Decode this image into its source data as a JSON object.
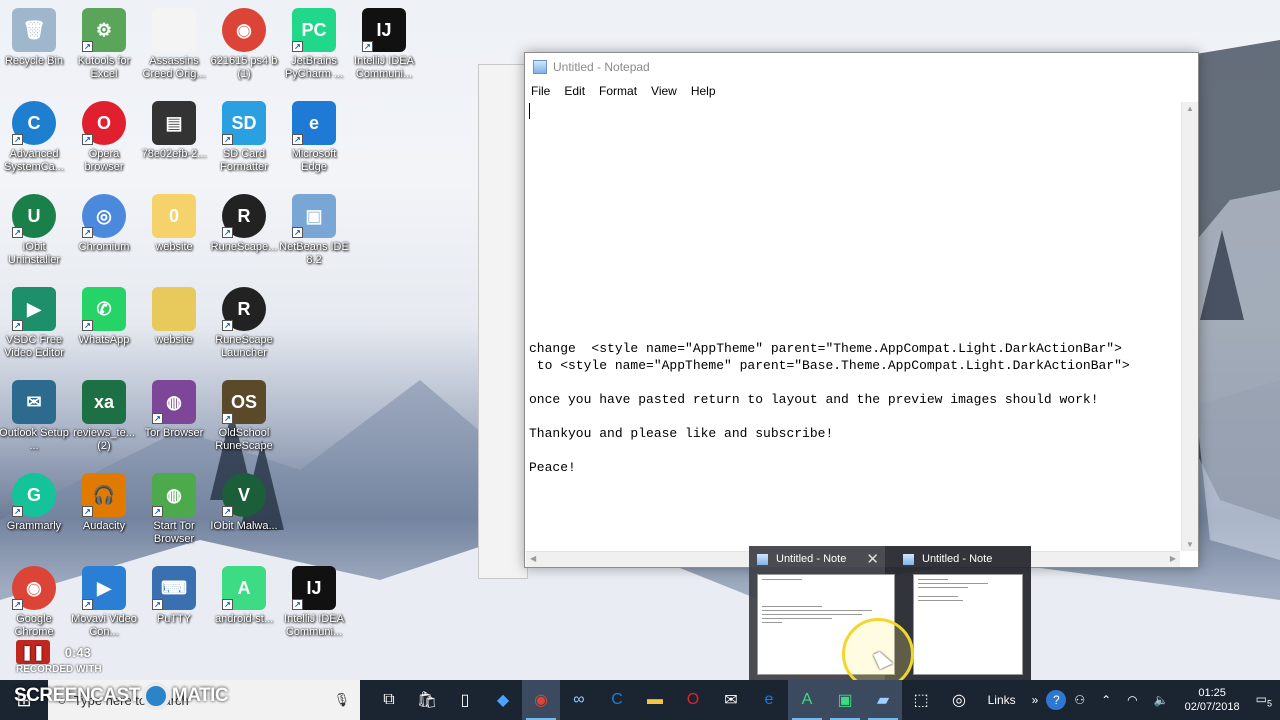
{
  "desktop": {
    "icons": [
      {
        "label": "Recycle Bin",
        "glyph": "🗑",
        "color": "#9fb7cc",
        "shortcut": false
      },
      {
        "label": "Kutools for Excel",
        "glyph": "⚙",
        "color": "#5aa55a",
        "shortcut": true
      },
      {
        "label": "Assassins Creed Orig...",
        "glyph": "",
        "color": "#f4f4f4",
        "shortcut": false
      },
      {
        "label": "621615 ps4 b (1)",
        "glyph": "◉",
        "color": "#db4437",
        "shortcut": false
      },
      {
        "label": "JetBrains PyCharm ...",
        "glyph": "PC",
        "color": "#21d789",
        "shortcut": true
      },
      {
        "label": "IntelliJ IDEA Communi...",
        "glyph": "IJ",
        "color": "#111111",
        "shortcut": true
      },
      {
        "label": "Advanced SystemCa...",
        "glyph": "C",
        "color": "#1e7fd0",
        "shortcut": true
      },
      {
        "label": "Opera browser",
        "glyph": "O",
        "color": "#e0202f",
        "shortcut": true
      },
      {
        "label": "78e02efb-2...",
        "glyph": "▤",
        "color": "#333333",
        "shortcut": false
      },
      {
        "label": "SD Card Formatter",
        "glyph": "SD",
        "color": "#2aa0e0",
        "shortcut": true
      },
      {
        "label": "Microsoft Edge",
        "glyph": "e",
        "color": "#1f7ad6",
        "shortcut": true
      },
      {
        "label": "IObit Uninstaller",
        "glyph": "U",
        "color": "#1b7f4a",
        "shortcut": true
      },
      {
        "label": "Chromium",
        "glyph": "◎",
        "color": "#4a89dc",
        "shortcut": true
      },
      {
        "label": "website",
        "glyph": "0",
        "color": "#f5d36a",
        "shortcut": false
      },
      {
        "label": "RuneScape...",
        "glyph": "R",
        "color": "#222222",
        "shortcut": true
      },
      {
        "label": "NetBeans IDE 8.2",
        "glyph": "▣",
        "color": "#7aa6d6",
        "shortcut": true
      },
      {
        "label": "VSDC Free Video Editor",
        "glyph": "▶",
        "color": "#1d8f6b",
        "shortcut": true
      },
      {
        "label": "WhatsApp",
        "glyph": "✆",
        "color": "#25d366",
        "shortcut": true
      },
      {
        "label": "website",
        "glyph": "",
        "color": "#e8c95c",
        "shortcut": false
      },
      {
        "label": "RuneScape Launcher",
        "glyph": "R",
        "color": "#222222",
        "shortcut": true
      },
      {
        "label": "Outlook Setup ...",
        "glyph": "✉",
        "color": "#2c6a8e",
        "shortcut": false
      },
      {
        "label": "reviews_te... (2)",
        "glyph": "xa",
        "color": "#1d7044",
        "shortcut": false
      },
      {
        "label": "Tor Browser",
        "glyph": "◍",
        "color": "#7d4698",
        "shortcut": true
      },
      {
        "label": "OldSchool RuneScape",
        "glyph": "OS",
        "color": "#5a4a2a",
        "shortcut": true
      },
      {
        "label": "Grammarly",
        "glyph": "G",
        "color": "#15c39a",
        "shortcut": true
      },
      {
        "label": "Audacity",
        "glyph": "🎧",
        "color": "#e07a00",
        "shortcut": true
      },
      {
        "label": "Start Tor Browser",
        "glyph": "◍",
        "color": "#4caa4c",
        "shortcut": true
      },
      {
        "label": "IObit Malwa...",
        "glyph": "V",
        "color": "#1b5f3a",
        "shortcut": true
      },
      {
        "label": "Google Chrome",
        "glyph": "◉",
        "color": "#db4437",
        "shortcut": true
      },
      {
        "label": "Movavi Video Con...",
        "glyph": "▶",
        "color": "#2a7fd4",
        "shortcut": true
      },
      {
        "label": "PuTTY",
        "glyph": "⌨",
        "color": "#3a6fb0",
        "shortcut": true
      },
      {
        "label": "android-st...",
        "glyph": "A",
        "color": "#3ddc84",
        "shortcut": true
      },
      {
        "label": "IntelliJ IDEA Communi...",
        "glyph": "IJ",
        "color": "#111111",
        "shortcut": true
      }
    ]
  },
  "notepad": {
    "title": "Untitled - Notepad",
    "menu": [
      "File",
      "Edit",
      "Format",
      "View",
      "Help"
    ],
    "content": "\n\n\n\n\n\n\n\n\n\n\nchange  <style name=\"AppTheme\" parent=\"Theme.AppCompat.Light.DarkActionBar\">\n to <style name=\"AppTheme\" parent=\"Base.Theme.AppCompat.Light.DarkActionBar\">\n\nonce you have pasted return to layout and the preview images should work!\n\nThankyou and please like and subscribe!\n\nPeace!"
  },
  "preview": {
    "items": [
      {
        "title": "Untitled - Note"
      },
      {
        "title": "Untitled - Note"
      }
    ]
  },
  "recorder": {
    "time": "0:43",
    "recorded_with": "RECORDED WITH",
    "brand_left": "SCREENCAST",
    "brand_right": "MATIC"
  },
  "taskbar": {
    "search_placeholder": "Type here to search",
    "links_label": "Links",
    "time": "01:25",
    "date": "02/07/2018",
    "notification_count": "5",
    "apps": [
      {
        "name": "task-view",
        "glyph": "⧉",
        "color": "#ffffff",
        "active": false
      },
      {
        "name": "store",
        "glyph": "🛍",
        "color": "#ffffff",
        "active": false
      },
      {
        "name": "file",
        "glyph": "▯",
        "color": "#ffffff",
        "active": false
      },
      {
        "name": "dropbox",
        "glyph": "◆",
        "color": "#4aa3ff",
        "active": false
      },
      {
        "name": "chrome",
        "glyph": "◉",
        "color": "#db4437",
        "active": true
      },
      {
        "name": "infinity",
        "glyph": "∞",
        "color": "#8fd0ff",
        "active": false
      },
      {
        "name": "ccleaner",
        "glyph": "C",
        "color": "#1e7fd0",
        "active": false
      },
      {
        "name": "file-explorer",
        "glyph": "▬",
        "color": "#f6c445",
        "active": false
      },
      {
        "name": "opera",
        "glyph": "O",
        "color": "#e0202f",
        "active": false
      },
      {
        "name": "mail",
        "glyph": "✉",
        "color": "#ffffff",
        "active": false
      },
      {
        "name": "edge",
        "glyph": "e",
        "color": "#1f7ad6",
        "active": false
      },
      {
        "name": "android-studio",
        "glyph": "A",
        "color": "#3ddc84",
        "active": true
      },
      {
        "name": "window",
        "glyph": "▣",
        "color": "#3ddc84",
        "active": true
      },
      {
        "name": "notepad",
        "glyph": "▰",
        "color": "#9fd0ff",
        "active": true
      },
      {
        "name": "snip",
        "glyph": "⬚",
        "color": "#ffffff",
        "active": false
      },
      {
        "name": "steam",
        "glyph": "◎",
        "color": "#ffffff",
        "active": false
      }
    ]
  }
}
